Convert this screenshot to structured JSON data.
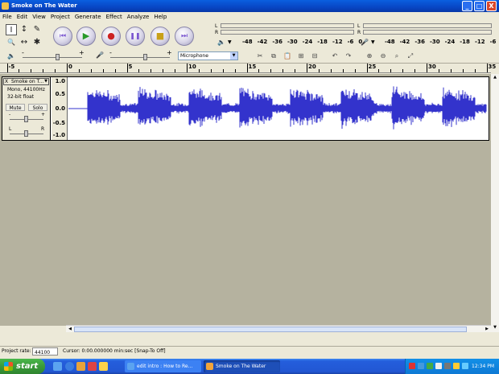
{
  "window": {
    "title": "Smoke on The Water",
    "controls": {
      "minimize": "_",
      "maximize": "□",
      "close": "X"
    }
  },
  "menu": [
    "File",
    "Edit",
    "View",
    "Project",
    "Generate",
    "Effect",
    "Analyze",
    "Help"
  ],
  "tools": {
    "selection": "I",
    "envelope": "↕",
    "draw": "✎",
    "zoom": "🔍",
    "timeshift": "↔",
    "multi": "✱"
  },
  "transport": {
    "skip_start": "⏮",
    "play": "▶",
    "record": "●",
    "pause": "❚❚",
    "stop": "■",
    "skip_end": "⏭"
  },
  "meters": {
    "left": "L",
    "right": "R",
    "scale": [
      "-48",
      "-42",
      "-36",
      "-30",
      "-24",
      "-18",
      "-12",
      "-6",
      "0"
    ]
  },
  "mixer": {
    "input_source": "Microphone",
    "output_volume": 0.6,
    "input_volume": 0.6
  },
  "ruler": {
    "labels": [
      "-5",
      "0",
      "5",
      "10",
      "15",
      "20",
      "25",
      "30",
      "35"
    ]
  },
  "track": {
    "name": "Smoke on T...",
    "close": "X",
    "menu_arrow": "▼",
    "format": "Mono, 44100Hz",
    "bit_depth": "32-bit float",
    "mute_label": "Mute",
    "solo_label": "Solo",
    "gain_minus": "-",
    "gain_plus": "+",
    "pan_left": "L",
    "pan_right": "R",
    "gain": 0.5,
    "pan": 0.5,
    "scale": [
      "1.0",
      "0.5",
      "0.0",
      "-0.5",
      "-1.0"
    ]
  },
  "status": {
    "project_rate_label": "Project rate:",
    "project_rate": "44100",
    "cursor": "Cursor: 0:00.000000 min:sec  [Snap-To Off]"
  },
  "taskbar": {
    "start": "start",
    "tasks": [
      {
        "label": "edit intro : How to Re..."
      },
      {
        "label": "Smoke on The Water"
      }
    ],
    "clock": "12:34 PM"
  },
  "colors": {
    "waveform": "#3333cc",
    "titlebar": "#0a5fe0",
    "record": "#cc2222",
    "play": "#2a9a2a"
  }
}
